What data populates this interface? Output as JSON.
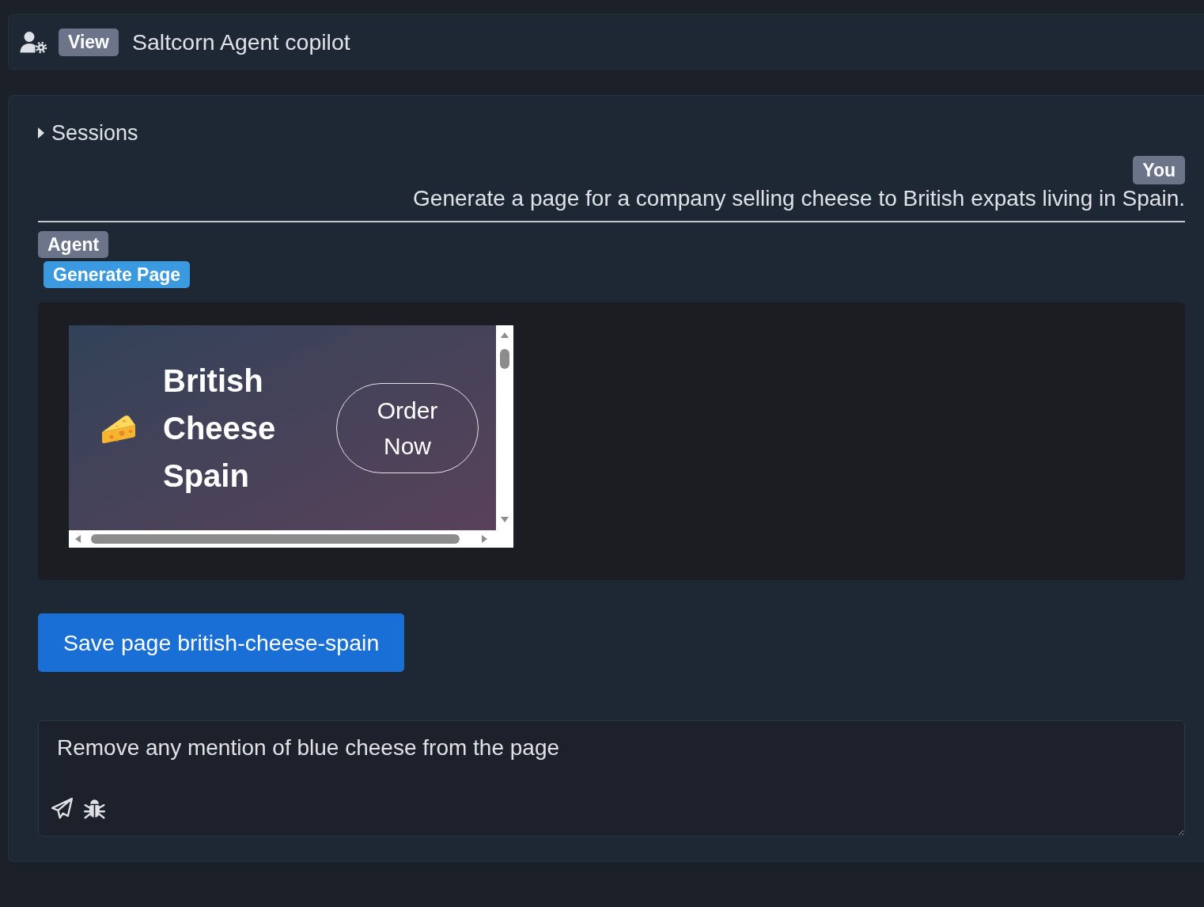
{
  "header": {
    "badge": "View",
    "title": "Saltcorn Agent copilot"
  },
  "sessions": {
    "label": "Sessions",
    "expanded": false
  },
  "messages": [
    {
      "kind": "user",
      "sender": "You",
      "text": "Generate a page for a company selling cheese to British expats living in Spain."
    },
    {
      "kind": "agent",
      "sender": "Agent",
      "action": "Generate Page",
      "preview": {
        "heading": "British Cheese Spain",
        "button": "Order Now"
      }
    }
  ],
  "save_button": {
    "label": "Save page british-cheese-spain"
  },
  "prompt": {
    "value": "Remove any mention of blue cheese from the page"
  }
}
